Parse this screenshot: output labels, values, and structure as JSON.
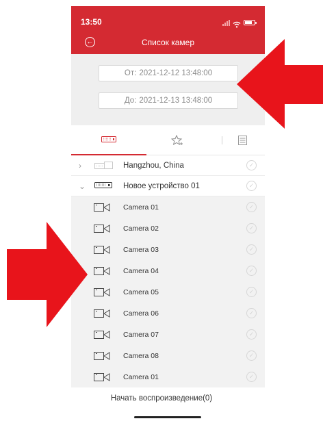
{
  "status_bar": {
    "time": "13:50"
  },
  "header": {
    "title": "Список камер",
    "back_icon": "back-circle-icon"
  },
  "date_filter": {
    "from_label": "От:",
    "from_value": "2021-12-12 13:48:00",
    "to_label": "До:",
    "to_value": "2021-12-13 13:48:00"
  },
  "tabs": [
    {
      "icon": "dvr-device-icon",
      "active": true
    },
    {
      "icon": "star-favorite-icon",
      "active": false
    },
    {
      "icon": "list-icon",
      "active": false
    }
  ],
  "device_list": {
    "devices": [
      {
        "name": "Hangzhou, China",
        "expanded": false,
        "icon": "offline-device-icon"
      },
      {
        "name": "Новое устройство 01",
        "expanded": true,
        "icon": "dvr-device-icon"
      }
    ],
    "cameras": [
      {
        "name": "Camera 01"
      },
      {
        "name": "Camera 02"
      },
      {
        "name": "Camera 03"
      },
      {
        "name": "Camera 04"
      },
      {
        "name": "Camera 05"
      },
      {
        "name": "Camera 06"
      },
      {
        "name": "Camera 07"
      },
      {
        "name": "Camera 08"
      },
      {
        "name": "Camera 01"
      }
    ]
  },
  "footer": {
    "play_button_label": "Начать воспроизведение(0)"
  },
  "colors": {
    "header_red": "#d42a32",
    "annotation_arrow": "#e8141b",
    "filter_background": "#efefef",
    "camera_row_background": "#f2f2f2"
  }
}
